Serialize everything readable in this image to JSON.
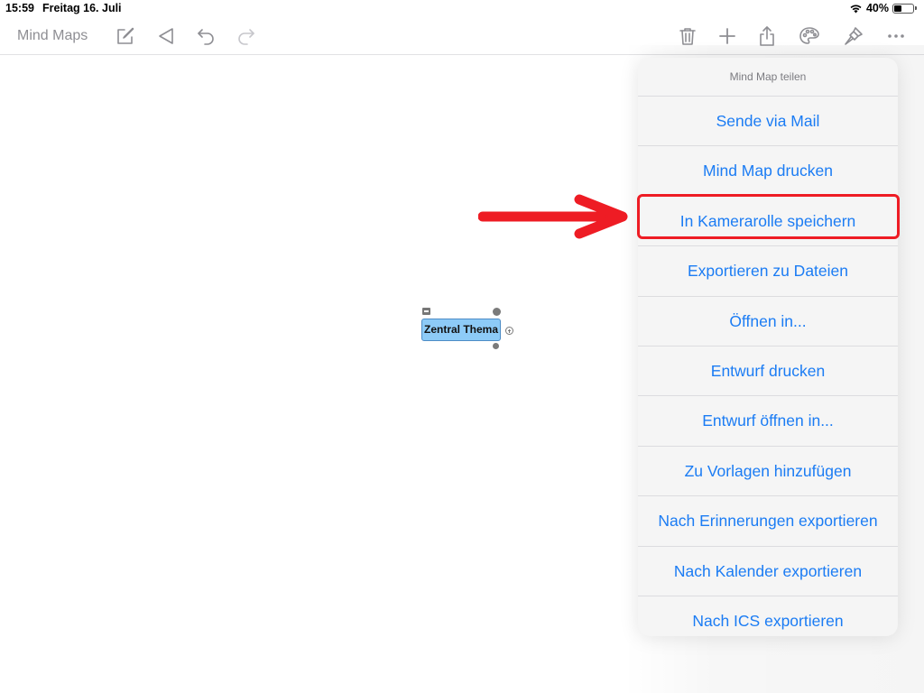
{
  "status_bar": {
    "time": "15:59",
    "date": "Freitag 16. Juli",
    "battery_percent": "40%",
    "battery_level": 0.4
  },
  "toolbar": {
    "title": "Mind Maps",
    "icons": [
      "compose-icon",
      "back-triangle-icon",
      "undo-icon",
      "redo-icon",
      "trash-icon",
      "add-icon",
      "share-icon",
      "palette-icon",
      "format-brush-icon",
      "more-icon"
    ]
  },
  "share_menu": {
    "header": "Mind Map teilen",
    "items": [
      "Sende via Mail",
      "Mind Map drucken",
      "In Kamerarolle speichern",
      "Exportieren zu Dateien",
      "Öffnen in...",
      "Entwurf drucken",
      "Entwurf öffnen in...",
      "Zu Vorlagen hinzufügen",
      "Nach Erinnerungen exportieren",
      "Nach Kalender exportieren",
      "Nach ICS exportieren"
    ],
    "highlighted_item": "In Kamerarolle speichern"
  },
  "mind_map": {
    "central_topic": "Zentral Thema"
  },
  "colors": {
    "accent": "#1b7cf4",
    "highlight": "#ee1c24",
    "node_fill": "#8dcbf7"
  }
}
